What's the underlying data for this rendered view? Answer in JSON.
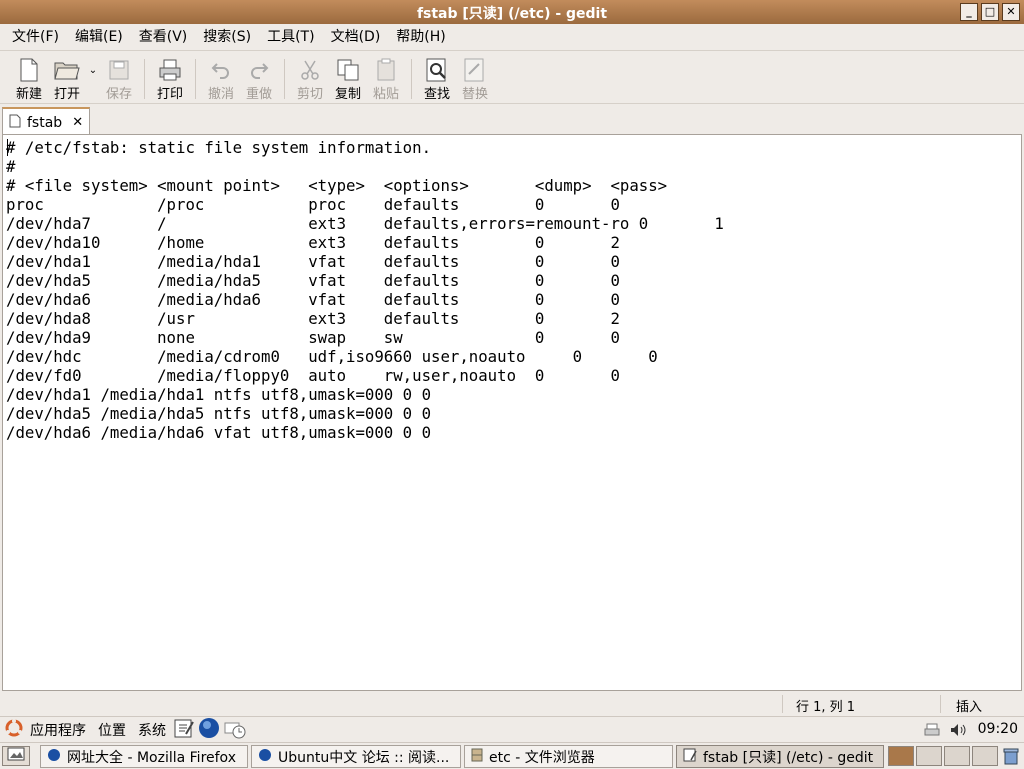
{
  "window": {
    "title": "fstab [只读] (/etc) - gedit",
    "buttons": {
      "minimize": "_",
      "maximize": "□",
      "close": "✕"
    }
  },
  "menubar": [
    "文件(F)",
    "编辑(E)",
    "查看(V)",
    "搜索(S)",
    "工具(T)",
    "文档(D)",
    "帮助(H)"
  ],
  "toolbar": {
    "new": "新建",
    "open": "打开",
    "save": "保存",
    "print": "打印",
    "undo": "撤消",
    "redo": "重做",
    "cut": "剪切",
    "copy": "复制",
    "paste": "粘贴",
    "find": "查找",
    "replace": "替换"
  },
  "tab": {
    "label": "fstab",
    "close": "✕"
  },
  "editor": {
    "content": "# /etc/fstab: static file system information.\n#\n# <file system> <mount point>   <type>  <options>       <dump>  <pass>\nproc            /proc           proc    defaults        0       0\n/dev/hda7       /               ext3    defaults,errors=remount-ro 0       1\n/dev/hda10      /home           ext3    defaults        0       2\n/dev/hda1       /media/hda1     vfat    defaults        0       0\n/dev/hda5       /media/hda5     vfat    defaults        0       0\n/dev/hda6       /media/hda6     vfat    defaults        0       0\n/dev/hda8       /usr            ext3    defaults        0       2\n/dev/hda9       none            swap    sw              0       0\n/dev/hdc        /media/cdrom0   udf,iso9660 user,noauto     0       0\n/dev/fd0        /media/floppy0  auto    rw,user,noauto  0       0\n/dev/hda1 /media/hda1 ntfs utf8,umask=000 0 0\n/dev/hda5 /media/hda5 ntfs utf8,umask=000 0 0\n/dev/hda6 /media/hda6 vfat utf8,umask=000 0 0"
  },
  "statusbar": {
    "position": "行 1, 列 1",
    "mode": "插入"
  },
  "panel": {
    "applications": "应用程序",
    "places": "位置",
    "system": "系统",
    "clock": "09:20"
  },
  "taskbar": {
    "tasks": [
      "网址大全 - Mozilla Firefox",
      "Ubuntu中文 论坛 :: 阅读...",
      "etc - 文件浏览器",
      "fstab [只读] (/etc) - gedit"
    ]
  },
  "colors": {
    "titlebar": "#b07a4b",
    "active_workspace": "#a9784a"
  }
}
